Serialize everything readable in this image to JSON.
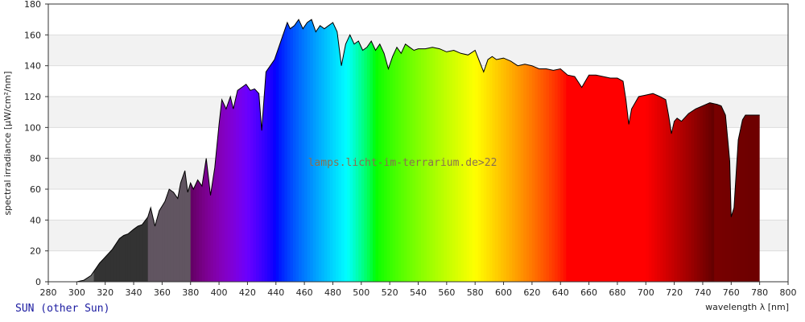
{
  "lamp_name": "SUN (other Sun)",
  "watermark": "lamps.licht-im-terrarium.de>22",
  "chart_data": {
    "type": "area",
    "xlabel": "wavelength λ [nm]",
    "ylabel": "spectral irradiance [µW/cm²/nm]",
    "xlim": [
      280,
      800
    ],
    "ylim": [
      0,
      180
    ],
    "xticks": [
      280,
      300,
      320,
      340,
      360,
      380,
      400,
      420,
      440,
      460,
      480,
      500,
      520,
      540,
      560,
      580,
      600,
      620,
      640,
      660,
      680,
      700,
      720,
      740,
      760,
      780,
      800
    ],
    "yticks": [
      0,
      20,
      40,
      60,
      80,
      100,
      120,
      140,
      160,
      180
    ],
    "grid": "horizontal bands",
    "fill": "visible spectrum colours; grey in UV; dark red in IR",
    "series": [
      {
        "x": [
          300,
          305,
          310,
          313,
          316,
          320,
          325,
          330,
          333,
          336,
          340,
          343,
          346,
          350,
          352,
          355,
          358,
          362,
          365,
          368,
          371,
          373,
          376,
          378,
          380,
          382,
          385,
          388,
          391,
          394,
          397,
          400,
          402,
          405,
          408,
          410,
          413,
          416,
          419,
          422,
          425,
          428,
          430,
          433,
          436,
          439,
          442,
          445,
          448,
          450,
          453,
          456,
          459,
          462,
          465,
          468,
          471,
          474,
          477,
          480,
          483,
          486,
          489,
          492,
          495,
          498,
          501,
          504,
          507,
          510,
          513,
          516,
          519,
          522,
          525,
          528,
          531,
          534,
          537,
          540,
          545,
          550,
          555,
          560,
          565,
          570,
          575,
          580,
          583,
          586,
          589,
          592,
          595,
          600,
          605,
          610,
          615,
          620,
          625,
          630,
          635,
          640,
          645,
          650,
          655,
          660,
          665,
          670,
          675,
          680,
          684,
          686,
          688,
          690,
          695,
          700,
          705,
          710,
          714,
          716,
          718,
          720,
          722,
          725,
          730,
          735,
          740,
          745,
          750,
          753,
          756,
          758,
          759,
          760,
          762,
          765,
          768,
          770,
          775,
          780
        ],
        "y": [
          0,
          1,
          4,
          8,
          12,
          16,
          21,
          28,
          30,
          31,
          34,
          36,
          37,
          42,
          48,
          36,
          46,
          52,
          60,
          58,
          54,
          64,
          72,
          58,
          64,
          60,
          66,
          62,
          80,
          56,
          74,
          102,
          118,
          112,
          120,
          112,
          124,
          126,
          128,
          124,
          125,
          122,
          98,
          136,
          140,
          144,
          152,
          160,
          168,
          164,
          166,
          170,
          164,
          168,
          170,
          162,
          166,
          164,
          166,
          168,
          162,
          140,
          154,
          160,
          154,
          156,
          150,
          152,
          156,
          150,
          154,
          148,
          138,
          146,
          152,
          148,
          154,
          152,
          150,
          151,
          151,
          152,
          151,
          149,
          150,
          148,
          147,
          150,
          143,
          136,
          144,
          146,
          144,
          145,
          143,
          140,
          141,
          140,
          138,
          138,
          137,
          138,
          134,
          133,
          126,
          134,
          134,
          133,
          132,
          132,
          130,
          118,
          102,
          112,
          120,
          121,
          122,
          120,
          118,
          108,
          96,
          104,
          106,
          104,
          109,
          112,
          114,
          116,
          115,
          114,
          108,
          88,
          78,
          42,
          48,
          92,
          105,
          108,
          108,
          108
        ]
      }
    ]
  }
}
